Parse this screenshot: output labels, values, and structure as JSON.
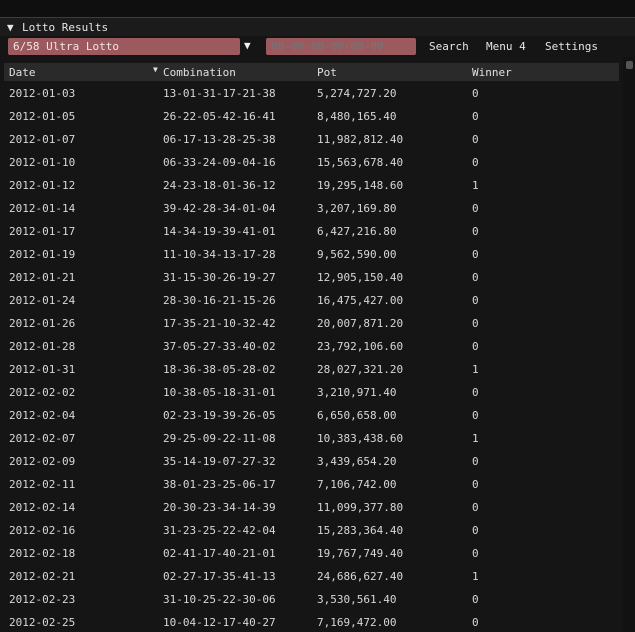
{
  "window": {
    "title": "Lotto Results"
  },
  "toolbar": {
    "game_value": "6/58 Ultra Lotto",
    "combination_placeholder": "00-00-00-00-00-00",
    "search_label": "Search",
    "menu4_label": "Menu 4",
    "settings_label": "Settings"
  },
  "table": {
    "columns": {
      "date": "Date",
      "combination": "Combination",
      "pot": "Pot",
      "winner": "Winner"
    },
    "sort": {
      "column": "date",
      "direction": "descending"
    },
    "rows": [
      {
        "date": "2012-01-03",
        "combination": "13-01-31-17-21-38",
        "pot": "5,274,727.20",
        "winner": "0"
      },
      {
        "date": "2012-01-05",
        "combination": "26-22-05-42-16-41",
        "pot": "8,480,165.40",
        "winner": "0"
      },
      {
        "date": "2012-01-07",
        "combination": "06-17-13-28-25-38",
        "pot": "11,982,812.40",
        "winner": "0"
      },
      {
        "date": "2012-01-10",
        "combination": "06-33-24-09-04-16",
        "pot": "15,563,678.40",
        "winner": "0"
      },
      {
        "date": "2012-01-12",
        "combination": "24-23-18-01-36-12",
        "pot": "19,295,148.60",
        "winner": "1"
      },
      {
        "date": "2012-01-14",
        "combination": "39-42-28-34-01-04",
        "pot": "3,207,169.80",
        "winner": "0"
      },
      {
        "date": "2012-01-17",
        "combination": "14-34-19-39-41-01",
        "pot": "6,427,216.80",
        "winner": "0"
      },
      {
        "date": "2012-01-19",
        "combination": "11-10-34-13-17-28",
        "pot": "9,562,590.00",
        "winner": "0"
      },
      {
        "date": "2012-01-21",
        "combination": "31-15-30-26-19-27",
        "pot": "12,905,150.40",
        "winner": "0"
      },
      {
        "date": "2012-01-24",
        "combination": "28-30-16-21-15-26",
        "pot": "16,475,427.00",
        "winner": "0"
      },
      {
        "date": "2012-01-26",
        "combination": "17-35-21-10-32-42",
        "pot": "20,007,871.20",
        "winner": "0"
      },
      {
        "date": "2012-01-28",
        "combination": "37-05-27-33-40-02",
        "pot": "23,792,106.60",
        "winner": "0"
      },
      {
        "date": "2012-01-31",
        "combination": "18-36-38-05-28-02",
        "pot": "28,027,321.20",
        "winner": "1"
      },
      {
        "date": "2012-02-02",
        "combination": "10-38-05-18-31-01",
        "pot": "3,210,971.40",
        "winner": "0"
      },
      {
        "date": "2012-02-04",
        "combination": "02-23-19-39-26-05",
        "pot": "6,650,658.00",
        "winner": "0"
      },
      {
        "date": "2012-02-07",
        "combination": "29-25-09-22-11-08",
        "pot": "10,383,438.60",
        "winner": "1"
      },
      {
        "date": "2012-02-09",
        "combination": "35-14-19-07-27-32",
        "pot": "3,439,654.20",
        "winner": "0"
      },
      {
        "date": "2012-02-11",
        "combination": "38-01-23-25-06-17",
        "pot": "7,106,742.00",
        "winner": "0"
      },
      {
        "date": "2012-02-14",
        "combination": "20-30-23-34-14-39",
        "pot": "11,099,377.80",
        "winner": "0"
      },
      {
        "date": "2012-02-16",
        "combination": "31-23-25-22-42-04",
        "pot": "15,283,364.40",
        "winner": "0"
      },
      {
        "date": "2012-02-18",
        "combination": "02-41-17-40-21-01",
        "pot": "19,767,749.40",
        "winner": "0"
      },
      {
        "date": "2012-02-21",
        "combination": "02-27-17-35-41-13",
        "pot": "24,686,627.40",
        "winner": "1"
      },
      {
        "date": "2012-02-23",
        "combination": "31-10-25-22-30-06",
        "pot": "3,530,561.40",
        "winner": "0"
      },
      {
        "date": "2012-02-25",
        "combination": "10-04-12-17-40-27",
        "pot": "7,169,472.00",
        "winner": "0"
      }
    ]
  },
  "icons": {
    "collapse": "triangle-down-icon",
    "combo_open": "triangle-down-icon",
    "sort": "sort-descending-icon"
  }
}
